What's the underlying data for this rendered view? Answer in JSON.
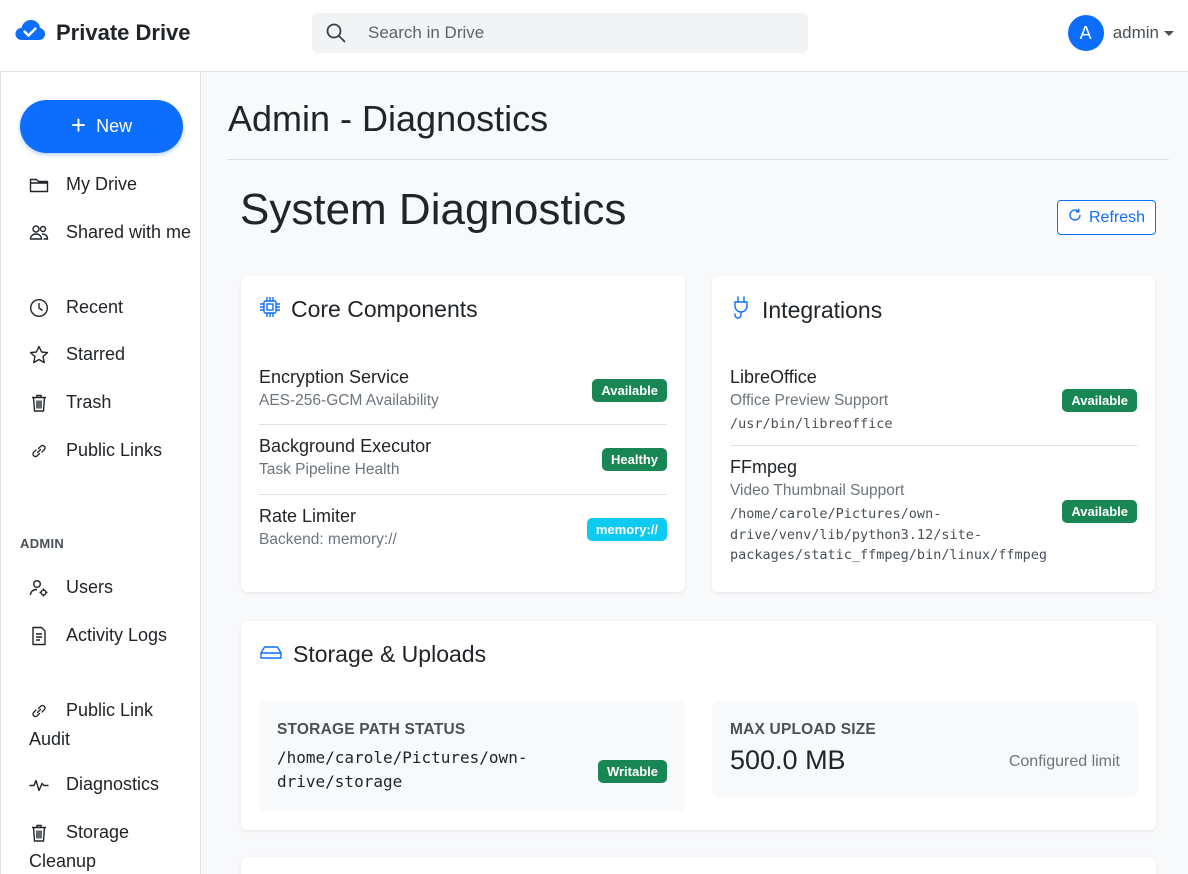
{
  "app": {
    "name": "Private Drive",
    "accent_color": "#0d6efd"
  },
  "search": {
    "placeholder": "Search in Drive"
  },
  "user": {
    "initial": "A",
    "name": "admin"
  },
  "sidebar": {
    "new_label": "New",
    "items": [
      {
        "label": "My Drive",
        "icon": "folder-icon"
      },
      {
        "label": "Shared with me",
        "icon": "people-icon"
      },
      {
        "label": "Recent",
        "icon": "clock-icon"
      },
      {
        "label": "Starred",
        "icon": "star-icon"
      },
      {
        "label": "Trash",
        "icon": "trash-icon"
      },
      {
        "label": "Public Links",
        "icon": "link-icon"
      }
    ],
    "admin_label": "ADMIN",
    "admin_items": [
      {
        "label": "Users",
        "icon": "user-gear-icon"
      },
      {
        "label": "Activity Logs",
        "icon": "journal-icon"
      },
      {
        "label": "Public Link Audit",
        "icon": "link-icon"
      },
      {
        "label": "Diagnostics",
        "icon": "pulse-icon"
      },
      {
        "label": "Storage Cleanup",
        "icon": "trash-icon"
      }
    ]
  },
  "main": {
    "page_title": "Admin - Diagnostics",
    "section_title": "System Diagnostics",
    "refresh_label": "Refresh",
    "core": {
      "title": "Core Components",
      "icon": "cpu-icon",
      "rows": [
        {
          "name": "Encryption Service",
          "sub": "AES-256-GCM Availability",
          "badge": "Available",
          "badge_color": "#198754"
        },
        {
          "name": "Background Executor",
          "sub": "Task Pipeline Health",
          "badge": "Healthy",
          "badge_color": "#198754"
        },
        {
          "name": "Rate Limiter",
          "sub": "Backend: memory://",
          "badge": "memory://",
          "badge_color": "#0dcaf0"
        }
      ]
    },
    "integrations": {
      "title": "Integrations",
      "icon": "plug-icon",
      "rows": [
        {
          "name": "LibreOffice",
          "sub": "Office Preview Support",
          "path": "/usr/bin/libreoffice",
          "badge": "Available"
        },
        {
          "name": "FFmpeg",
          "sub": "Video Thumbnail Support",
          "path": "/home/carole/Pictures/own-drive/venv/lib/python3.12/site-packages/static_ffmpeg/bin/linux/ffmpeg",
          "path_lines": [
            "/home/carole/Pictures/own-",
            "drive/venv/lib/python3.12/site-",
            "packages/static_ffmpeg/bin/linux/ffmpeg"
          ],
          "badge": "Available"
        }
      ]
    },
    "storage": {
      "title": "Storage & Uploads",
      "icon": "hdd-icon",
      "path_label": "STORAGE PATH STATUS",
      "path": "/home/carole/Pictures/own-drive/storage",
      "path_lines": [
        "/home/carole/Pictures/own-",
        "drive/storage"
      ],
      "path_badge": "Writable",
      "upload_label": "MAX UPLOAD SIZE",
      "upload_value": "500.0 MB",
      "upload_note": "Configured limit"
    }
  }
}
